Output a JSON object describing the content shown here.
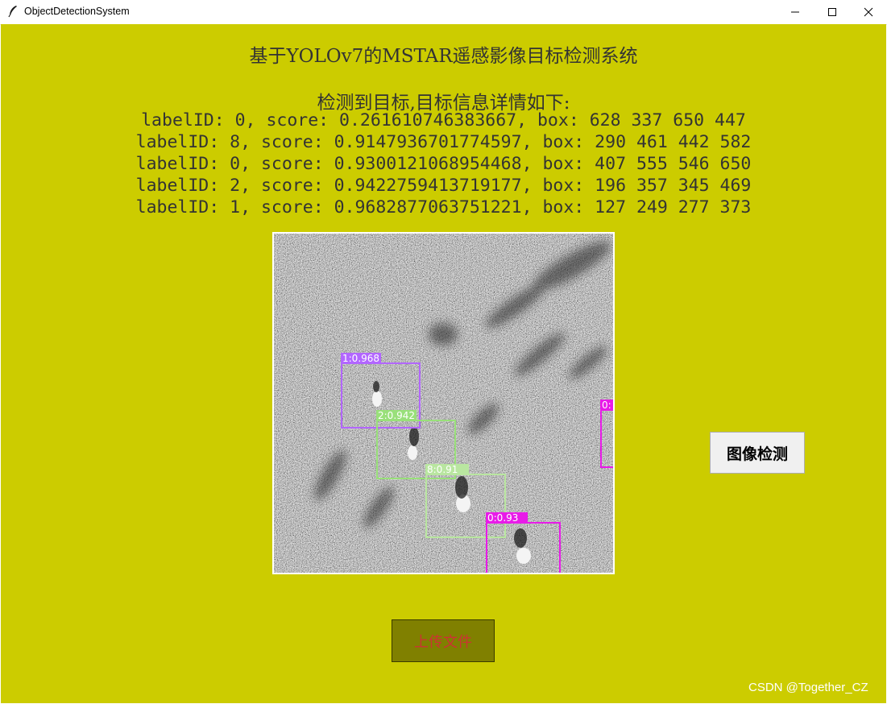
{
  "window": {
    "title": "ObjectDetectionSystem",
    "controls": {
      "minimize": "minimize-icon",
      "maximize": "maximize-icon",
      "close": "close-icon"
    }
  },
  "app": {
    "title": "基于YOLOv7的MSTAR遥感影像目标检测系统",
    "result_header": "检测到目标,目标信息详情如下:",
    "detections": [
      "labelID: 0, score: 0.261610746383667, box: 628 337 650 447",
      "labelID: 8, score: 0.9147936701774597, box: 290 461 442 582",
      "labelID: 0, score: 0.9300121068954468, box: 407 555 546 650",
      "labelID: 2, score: 0.9422759413719177, box: 196 357 345 469",
      "labelID: 1, score: 0.9682877063751221, box: 127 249 277 373"
    ],
    "image_labels": {
      "det_1": "1:0.968",
      "det_2": "2:0.942",
      "det_8": "8:0.91",
      "det_0b": "0:0.93",
      "det_0a": "0:"
    },
    "colors": {
      "background": "#cccc00",
      "label_1": "#b266ff",
      "label_2": "#99e07a",
      "label_8": "#b9e6a0",
      "label_0": "#e81be8"
    },
    "buttons": {
      "detect": "图像检测",
      "upload": "上传文件"
    },
    "watermark": "CSDN @Together_CZ"
  }
}
